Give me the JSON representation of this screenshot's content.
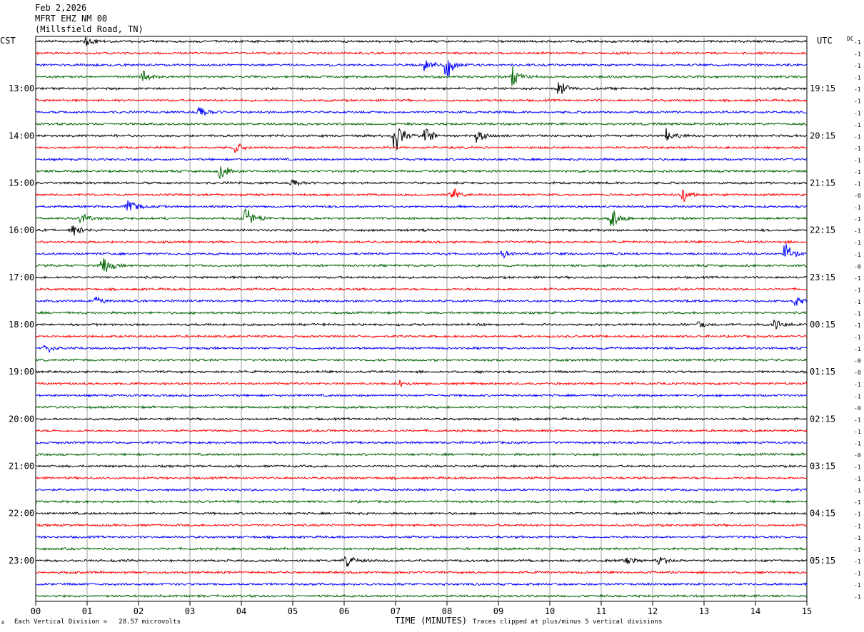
{
  "header": {
    "date": "Feb 2,2026",
    "station": "MFRT EHZ NM 00",
    "location": "(Millsfield Road, TN)"
  },
  "left_zone_label": "CST",
  "right_zone_label": "UTC",
  "dc_label": "DC",
  "footer": {
    "scale_note": "Each Vertical Division =   28.57 microvolts",
    "clip_note": "Traces clipped at plus/minus 5 vertical divisions",
    "corner_mark": "A"
  },
  "colors": {
    "trace_cycle": [
      "#000000",
      "#ff0000",
      "#0000ff",
      "#006400"
    ],
    "grid": "#888888",
    "frame": "#000000"
  },
  "chart_data": {
    "type": "line",
    "title": "MFRT EHZ NM 00",
    "xlabel": "TIME (MINUTES)",
    "ylabel": "",
    "xlim": [
      0,
      15
    ],
    "x_ticks": [
      "00",
      "01",
      "02",
      "03",
      "04",
      "05",
      "06",
      "07",
      "08",
      "09",
      "10",
      "11",
      "12",
      "13",
      "14",
      "15"
    ],
    "rows_per_hour": 4,
    "row_count": 48,
    "left_hour_labels": [
      "13:00",
      "14:00",
      "15:00",
      "16:00",
      "17:00",
      "18:00",
      "19:00",
      "20:00",
      "21:00",
      "22:00",
      "23:00"
    ],
    "right_hour_labels": [
      "19:15",
      "20:15",
      "21:15",
      "22:15",
      "23:15",
      "00:15",
      "01:15",
      "02:15",
      "03:15",
      "04:15",
      "05:15"
    ],
    "dc_offsets": [
      "-1",
      "-1",
      "-1",
      "-1",
      "-1",
      "-1",
      "-1",
      "-1",
      "-1",
      "-1",
      "-1",
      "-1",
      "-1",
      "-0",
      "-1",
      "-1",
      "-1",
      "-1",
      "-1",
      "-0",
      "-1",
      "-1",
      "-1",
      "-1",
      "-1",
      "-1",
      "-1",
      "-0",
      "-0",
      "-1",
      "-1",
      "-0",
      "-1",
      "-1",
      "-1",
      "-0",
      "-1",
      "-1",
      "-1",
      "-1",
      "-1",
      "-1",
      "-1",
      "-1",
      "-1",
      "-1",
      "-1",
      "-1"
    ],
    "events": [
      {
        "row": 0,
        "minute": 1.0,
        "amp": 0.35
      },
      {
        "row": 2,
        "minute": 8.0,
        "amp": 0.8
      },
      {
        "row": 2,
        "minute": 7.6,
        "amp": 0.4
      },
      {
        "row": 3,
        "minute": 9.3,
        "amp": 0.7
      },
      {
        "row": 3,
        "minute": 2.1,
        "amp": 0.3
      },
      {
        "row": 4,
        "minute": 10.2,
        "amp": 0.45
      },
      {
        "row": 6,
        "minute": 3.2,
        "amp": 0.45
      },
      {
        "row": 8,
        "minute": 7.0,
        "amp": 1.0
      },
      {
        "row": 8,
        "minute": 7.6,
        "amp": 0.55
      },
      {
        "row": 8,
        "minute": 8.6,
        "amp": 0.45
      },
      {
        "row": 8,
        "minute": 12.3,
        "amp": 0.35
      },
      {
        "row": 9,
        "minute": 3.9,
        "amp": 0.3
      },
      {
        "row": 11,
        "minute": 3.6,
        "amp": 0.5
      },
      {
        "row": 12,
        "minute": 5.0,
        "amp": 0.3
      },
      {
        "row": 13,
        "minute": 8.1,
        "amp": 0.45
      },
      {
        "row": 13,
        "minute": 12.6,
        "amp": 0.35
      },
      {
        "row": 14,
        "minute": 1.8,
        "amp": 0.55
      },
      {
        "row": 15,
        "minute": 4.1,
        "amp": 0.75
      },
      {
        "row": 15,
        "minute": 11.2,
        "amp": 0.55
      },
      {
        "row": 15,
        "minute": 0.9,
        "amp": 0.35
      },
      {
        "row": 16,
        "minute": 0.75,
        "amp": 0.45
      },
      {
        "row": 18,
        "minute": 14.6,
        "amp": 0.55
      },
      {
        "row": 18,
        "minute": 9.1,
        "amp": 0.3
      },
      {
        "row": 19,
        "minute": 1.3,
        "amp": 0.65
      },
      {
        "row": 22,
        "minute": 1.2,
        "amp": 0.3
      },
      {
        "row": 22,
        "minute": 14.8,
        "amp": 0.3
      },
      {
        "row": 24,
        "minute": 12.9,
        "amp": 0.25
      },
      {
        "row": 24,
        "minute": 14.4,
        "amp": 0.25
      },
      {
        "row": 26,
        "minute": 0.2,
        "amp": 0.3
      },
      {
        "row": 29,
        "minute": 7.1,
        "amp": 0.25
      },
      {
        "row": 44,
        "minute": 6.05,
        "amp": 0.55
      },
      {
        "row": 44,
        "minute": 12.1,
        "amp": 0.35
      },
      {
        "row": 44,
        "minute": 11.5,
        "amp": 0.2
      }
    ]
  }
}
